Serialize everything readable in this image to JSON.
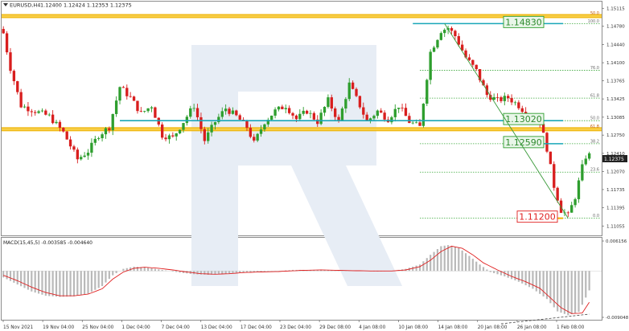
{
  "header": {
    "symbol_label": "EURUSD,H4",
    "ohlc_label": "1.12400 1.12424 1.12353 1.12375"
  },
  "macd_label": "MACD(15,45,5) -0.003585 -0.004640",
  "current_price_label": "1.12375",
  "chart_data": [
    {
      "type": "candlestick",
      "title": "EURUSD,H4",
      "ylim": [
        1.1088,
        1.1524
      ],
      "y_ticks": [
        "1.15115",
        "1.14780",
        "1.14440",
        "1.14100",
        "1.13765",
        "1.13425",
        "1.13085",
        "1.12750",
        "1.12410",
        "1.12070",
        "1.11735",
        "1.11395",
        "1.11055"
      ],
      "y_tick_values": [
        1.15115,
        1.1478,
        1.1444,
        1.141,
        1.13765,
        1.13425,
        1.13085,
        1.1275,
        1.1241,
        1.1207,
        1.11735,
        1.11395,
        1.11055
      ],
      "x_ticks": [
        "15 Nov 2021",
        "19 Nov 04:00",
        "25 Nov 04:00",
        "1 Dec 04:00",
        "7 Dec 04:00",
        "13 Dec 04:00",
        "17 Dec 04:00",
        "23 Dec 04:00",
        "29 Dec 08:00",
        "4 Jan 08:00",
        "10 Jan 08:00",
        "14 Jan 08:00",
        "20 Jan 08:00",
        "26 Jan 08:00",
        "1 Feb 08:00"
      ],
      "approx_path": [
        [
          0,
          1.1465
        ],
        [
          2,
          1.14
        ],
        [
          5,
          1.133
        ],
        [
          9,
          1.132
        ],
        [
          13,
          1.131
        ],
        [
          17,
          1.128
        ],
        [
          21,
          1.123
        ],
        [
          24,
          1.1245
        ],
        [
          27,
          1.1275
        ],
        [
          30,
          1.129
        ],
        [
          33,
          1.1365
        ],
        [
          36,
          1.1345
        ],
        [
          39,
          1.1315
        ],
        [
          42,
          1.133
        ],
        [
          45,
          1.1275
        ],
        [
          48,
          1.127
        ],
        [
          51,
          1.13
        ],
        [
          54,
          1.133
        ],
        [
          57,
          1.1265
        ],
        [
          60,
          1.13
        ],
        [
          63,
          1.1325
        ],
        [
          66,
          1.131
        ],
        [
          69,
          1.129
        ],
        [
          71,
          1.126
        ],
        [
          74,
          1.13
        ],
        [
          77,
          1.132
        ],
        [
          80,
          1.133
        ],
        [
          83,
          1.1305
        ],
        [
          86,
          1.132
        ],
        [
          89,
          1.13
        ],
        [
          92,
          1.134
        ],
        [
          95,
          1.13
        ],
        [
          98,
          1.137
        ],
        [
          101,
          1.133
        ],
        [
          103,
          1.13
        ],
        [
          106,
          1.132
        ],
        [
          109,
          1.1305
        ],
        [
          112,
          1.133
        ],
        [
          115,
          1.13
        ],
        [
          118,
          1.129
        ],
        [
          121,
          1.143
        ],
        [
          124,
          1.147
        ],
        [
          126,
          1.1475
        ],
        [
          128,
          1.146
        ],
        [
          131,
          1.142
        ],
        [
          134,
          1.1395
        ],
        [
          137,
          1.135
        ],
        [
          140,
          1.134
        ],
        [
          143,
          1.1345
        ],
        [
          146,
          1.133
        ],
        [
          149,
          1.131
        ],
        [
          152,
          1.13
        ],
        [
          154,
          1.125
        ],
        [
          156,
          1.118
        ],
        [
          158,
          1.1135
        ],
        [
          160,
          1.1125
        ],
        [
          162,
          1.116
        ],
        [
          164,
          1.1215
        ],
        [
          165,
          1.1235
        ],
        [
          166,
          1.12375
        ]
      ],
      "horizontal_levels": [
        {
          "label": "1.14830",
          "value": 1.1483
        },
        {
          "label": "1.13020",
          "value": 1.1302
        },
        {
          "label": "1.12590",
          "value": 1.1259
        },
        {
          "label": "1.11200",
          "value": 1.112
        }
      ],
      "support_resistance_zones": [
        1.1497,
        1.1286
      ],
      "fibonacci": {
        "from": 1.1483,
        "to": 1.112,
        "levels": [
          {
            "label": "100.0",
            "value": 1.1483
          },
          {
            "label": "76.0",
            "value": 1.1396
          },
          {
            "label": "61.8",
            "value": 1.1344
          },
          {
            "label": "50.0",
            "value": 1.1302
          },
          {
            "label": "38.2",
            "value": 1.1259
          },
          {
            "label": "23.6",
            "value": 1.1206
          },
          {
            "label": "0.0",
            "value": 1.112
          }
        ],
        "extension_labels": [
          {
            "label": "50.0",
            "value": 1.1497
          },
          {
            "label": "61.8",
            "value": 1.1286
          }
        ]
      },
      "colors": {
        "up": "#2e9e2e",
        "down": "#d81e1e",
        "level": "#19a7b8",
        "zone": "#f0b400",
        "fib": "#3aa83a",
        "trend": "#3a9a3a"
      }
    },
    {
      "type": "histogram-line",
      "title": "MACD(15,45,5)",
      "ylim": [
        -0.009048,
        0.006156
      ],
      "y_ticks": [
        "0.006156",
        "-0.009048"
      ],
      "histogram_path": [
        [
          0,
          -0.0012
        ],
        [
          4,
          -0.0025
        ],
        [
          8,
          -0.0038
        ],
        [
          12,
          -0.0046
        ],
        [
          16,
          -0.0048
        ],
        [
          20,
          -0.0047
        ],
        [
          24,
          -0.0042
        ],
        [
          28,
          -0.0028
        ],
        [
          31,
          -0.0008
        ],
        [
          34,
          0.0004
        ],
        [
          37,
          0.0008
        ],
        [
          40,
          0.0007
        ],
        [
          43,
          0.0004
        ],
        [
          46,
          0.0001
        ],
        [
          50,
          -0.0003
        ],
        [
          54,
          -0.0006
        ],
        [
          58,
          -0.0007
        ],
        [
          62,
          -0.0006
        ],
        [
          66,
          -0.0003
        ],
        [
          70,
          -0.0002
        ],
        [
          74,
          -0.0001
        ],
        [
          78,
          0.0
        ],
        [
          82,
          0.0002
        ],
        [
          86,
          0.0002
        ],
        [
          90,
          0.0002
        ],
        [
          94,
          0.0001
        ],
        [
          98,
          0.0001
        ],
        [
          102,
          0.0
        ],
        [
          106,
          -0.0001
        ],
        [
          110,
          0.0
        ],
        [
          114,
          0.0004
        ],
        [
          118,
          0.0012
        ],
        [
          121,
          0.003
        ],
        [
          124,
          0.0046
        ],
        [
          126,
          0.0048
        ],
        [
          129,
          0.0043
        ],
        [
          132,
          0.0028
        ],
        [
          135,
          0.0012
        ],
        [
          138,
          -0.0002
        ],
        [
          142,
          -0.001
        ],
        [
          146,
          -0.002
        ],
        [
          150,
          -0.0033
        ],
        [
          154,
          -0.0052
        ],
        [
          157,
          -0.0075
        ],
        [
          160,
          -0.0082
        ],
        [
          163,
          -0.0076
        ],
        [
          166,
          -0.0036
        ]
      ],
      "signal_path": [
        [
          0,
          -0.0008
        ],
        [
          4,
          -0.0018
        ],
        [
          8,
          -0.003
        ],
        [
          12,
          -0.004
        ],
        [
          16,
          -0.0046
        ],
        [
          20,
          -0.0046
        ],
        [
          24,
          -0.0043
        ],
        [
          28,
          -0.0033
        ],
        [
          31,
          -0.0015
        ],
        [
          34,
          -0.0002
        ],
        [
          37,
          0.0005
        ],
        [
          40,
          0.0007
        ],
        [
          44,
          0.0005
        ],
        [
          48,
          0.0002
        ],
        [
          52,
          -0.0002
        ],
        [
          56,
          -0.0005
        ],
        [
          60,
          -0.0006
        ],
        [
          64,
          -0.0005
        ],
        [
          68,
          -0.0003
        ],
        [
          72,
          -0.0002
        ],
        [
          78,
          -0.0001
        ],
        [
          84,
          0.0001
        ],
        [
          90,
          0.0002
        ],
        [
          96,
          0.0001
        ],
        [
          104,
          0.0
        ],
        [
          110,
          0.0
        ],
        [
          114,
          0.0002
        ],
        [
          118,
          0.0008
        ],
        [
          121,
          0.002
        ],
        [
          124,
          0.0036
        ],
        [
          127,
          0.0046
        ],
        [
          130,
          0.0042
        ],
        [
          133,
          0.003
        ],
        [
          136,
          0.0015
        ],
        [
          140,
          0.0002
        ],
        [
          144,
          -0.001
        ],
        [
          148,
          -0.002
        ],
        [
          152,
          -0.0032
        ],
        [
          155,
          -0.005
        ],
        [
          158,
          -0.0068
        ],
        [
          161,
          -0.0079
        ],
        [
          164,
          -0.0078
        ],
        [
          166,
          -0.0058
        ]
      ],
      "divergence_line": [
        [
          141,
          -0.0098
        ],
        [
          166,
          -0.008
        ]
      ],
      "colors": {
        "histogram": "#b9b9b9",
        "signal": "#e02020",
        "divergence": "#444444"
      }
    }
  ]
}
